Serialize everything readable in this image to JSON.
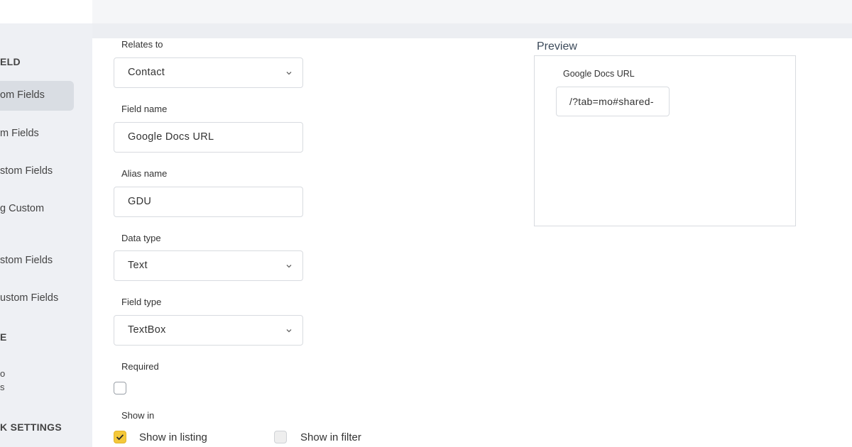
{
  "sidebar": {
    "section1": "ELD",
    "items": [
      {
        "label": "om Fields"
      },
      {
        "label": "m Fields"
      },
      {
        "label": "stom Fields"
      },
      {
        "label": "g Custom"
      },
      {
        "label": "stom Fields"
      },
      {
        "label": "ustom Fields"
      }
    ],
    "section2": "E",
    "fragment1": "o",
    "fragment2": "s",
    "section3": "K SETTINGS"
  },
  "form": {
    "relates_to": {
      "label": "Relates to",
      "value": "Contact"
    },
    "field_name": {
      "label": "Field name",
      "value": "Google Docs URL"
    },
    "alias_name": {
      "label": "Alias name",
      "value": "GDU"
    },
    "data_type": {
      "label": "Data type",
      "value": "Text"
    },
    "field_type": {
      "label": "Field type",
      "value": "TextBox"
    },
    "required": {
      "label": "Required",
      "checked": false
    },
    "show_in": {
      "label": "Show in",
      "listing": {
        "label": "Show in listing",
        "checked": true
      },
      "filter": {
        "label": "Show in filter",
        "checked": false
      }
    }
  },
  "preview": {
    "title": "Preview",
    "field_label": "Google Docs URL",
    "field_value": "/?tab=mo#shared-"
  },
  "colors": {
    "accent": "#f4c83a",
    "sidebar_bg": "#eef0f4",
    "active_item_bg": "#d9dde3"
  }
}
